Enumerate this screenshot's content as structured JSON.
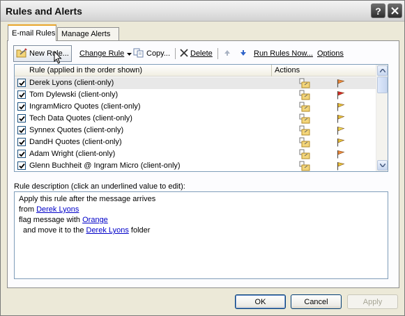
{
  "window": {
    "title": "Rules and Alerts"
  },
  "tabs": [
    {
      "label": "E-mail Rules"
    },
    {
      "label": "Manage Alerts"
    }
  ],
  "toolbar": {
    "new_rule": "New Rule...",
    "change_rule": "Change Rule",
    "copy": "Copy...",
    "delete": "Delete",
    "run_rules": "Run Rules Now...",
    "options": "Options"
  },
  "rules_table": {
    "col_rule": "Rule (applied in the order shown)",
    "col_actions": "Actions",
    "rows": [
      {
        "label": "Derek Lyons  (client-only)",
        "checked": true,
        "flag_color": "#f08a3c"
      },
      {
        "label": "Tom Dylewski  (client-only)",
        "checked": true,
        "flag_color": "#d9262b"
      },
      {
        "label": "IngramMicro Quotes  (client-only)",
        "checked": true,
        "flag_color": "#e9c63a"
      },
      {
        "label": "Tech Data Quotes  (client-only)",
        "checked": true,
        "flag_color": "#e9c63a"
      },
      {
        "label": "Synnex Quotes  (client-only)",
        "checked": true,
        "flag_color": "#f2dc52"
      },
      {
        "label": "DandH Quotes  (client-only)",
        "checked": true,
        "flag_color": "#e9c63a"
      },
      {
        "label": "Adam Wright  (client-only)",
        "checked": true,
        "flag_color": "#f08a3c"
      },
      {
        "label": "Glenn Buchheit @ Ingram Micro  (client-only)",
        "checked": true,
        "flag_color": "#e9c63a"
      }
    ]
  },
  "description": {
    "label": "Rule description (click an underlined value to edit):",
    "line1": "Apply this rule after the message arrives",
    "line2_prefix": "from ",
    "line2_link": "Derek Lyons",
    "line3_prefix": "flag message with ",
    "line3_link": "Orange",
    "line4_prefix": "and move it to the ",
    "line4_link": "Derek Lyons",
    "line4_suffix": " folder"
  },
  "buttons": {
    "ok": "OK",
    "cancel": "Cancel",
    "apply": "Apply"
  }
}
